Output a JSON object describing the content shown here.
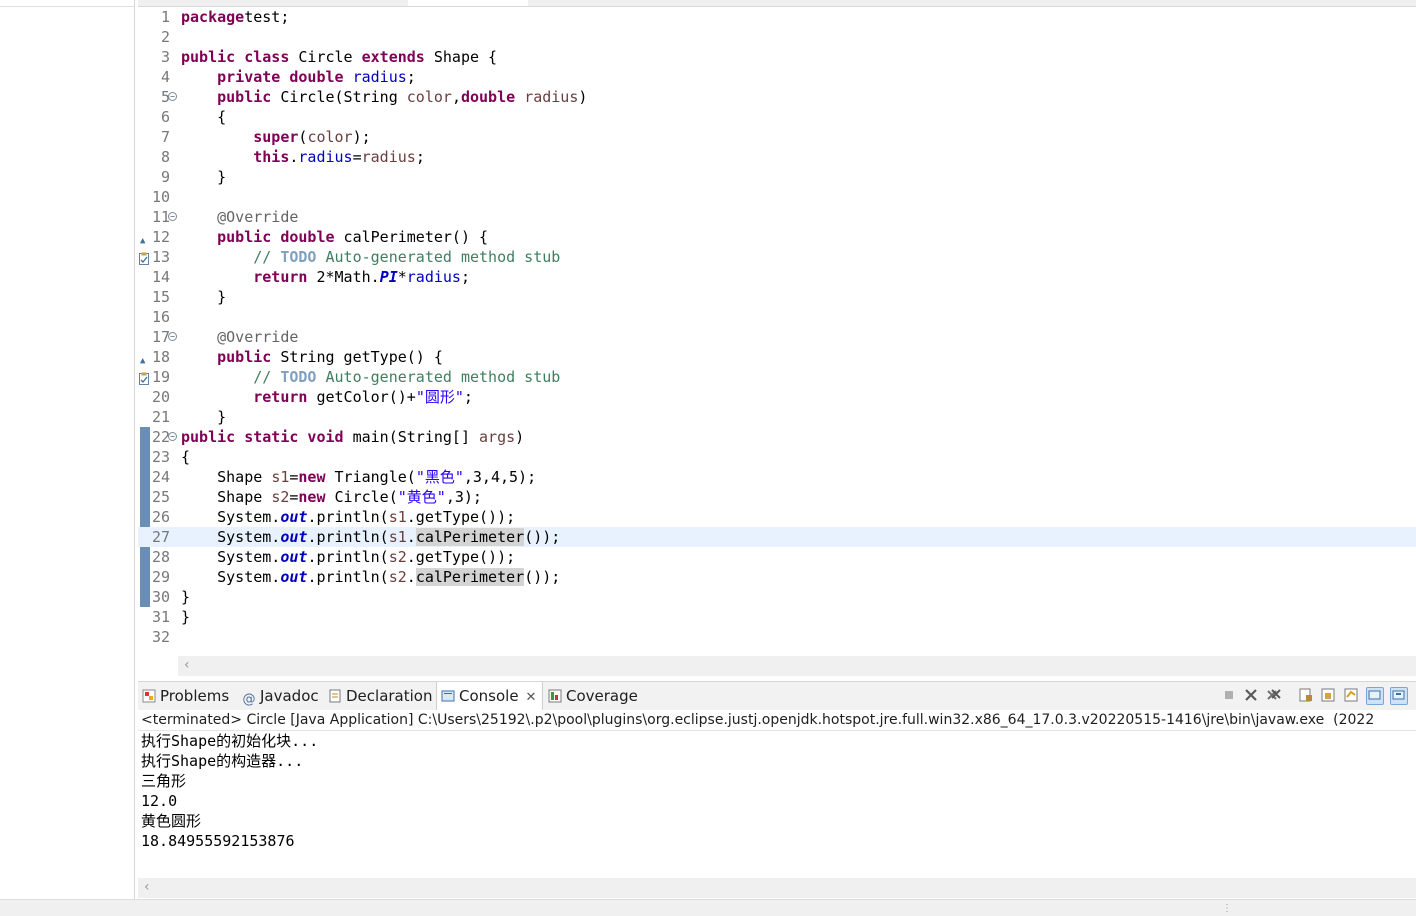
{
  "editor": {
    "lines": [
      {
        "n": "1",
        "parts": [
          [
            "kw",
            "package"
          ],
          [
            "",
            "test;"
          ]
        ]
      },
      {
        "n": "2",
        "parts": []
      },
      {
        "n": "3",
        "parts": [
          [
            "kw",
            "public class"
          ],
          [
            "",
            " Circle "
          ],
          [
            "kw",
            "extends"
          ],
          [
            "",
            " Shape {"
          ]
        ]
      },
      {
        "n": "4",
        "parts": [
          [
            "",
            "    "
          ],
          [
            "kw",
            "private double"
          ],
          [
            "",
            " "
          ],
          [
            "fld",
            "radius"
          ],
          [
            "",
            ";"
          ]
        ]
      },
      {
        "n": "5",
        "fold": true,
        "parts": [
          [
            "",
            "    "
          ],
          [
            "kw",
            "public"
          ],
          [
            "",
            " Circle(String "
          ],
          [
            "param",
            "color"
          ],
          [
            "",
            ","
          ],
          [
            "kw",
            "double"
          ],
          [
            "",
            " "
          ],
          [
            "param",
            "radius"
          ],
          [
            "",
            ")"
          ]
        ]
      },
      {
        "n": "6",
        "parts": [
          [
            "",
            "    {"
          ]
        ]
      },
      {
        "n": "7",
        "parts": [
          [
            "",
            "        "
          ],
          [
            "kw",
            "super"
          ],
          [
            "",
            "("
          ],
          [
            "param",
            "color"
          ],
          [
            "",
            ");"
          ]
        ]
      },
      {
        "n": "8",
        "parts": [
          [
            "",
            "        "
          ],
          [
            "kw",
            "this"
          ],
          [
            "",
            "."
          ],
          [
            "fld",
            "radius"
          ],
          [
            "",
            "="
          ],
          [
            "param",
            "radius"
          ],
          [
            "",
            ";"
          ]
        ]
      },
      {
        "n": "9",
        "parts": [
          [
            "",
            "    }"
          ]
        ]
      },
      {
        "n": "10",
        "parts": []
      },
      {
        "n": "11",
        "fold": true,
        "parts": [
          [
            "",
            "    "
          ],
          [
            "ann",
            "@Override"
          ]
        ]
      },
      {
        "n": "12",
        "override": true,
        "parts": [
          [
            "",
            "    "
          ],
          [
            "kw",
            "public double"
          ],
          [
            "",
            " calPerimeter() {"
          ]
        ]
      },
      {
        "n": "13",
        "task": true,
        "parts": [
          [
            "",
            "        "
          ],
          [
            "cmt",
            "// "
          ],
          [
            "todo",
            "TODO"
          ],
          [
            "cmt",
            " Auto-generated method stub"
          ]
        ]
      },
      {
        "n": "14",
        "parts": [
          [
            "",
            "        "
          ],
          [
            "kw",
            "return"
          ],
          [
            "",
            " 2*Math."
          ],
          [
            "sfld",
            "PI"
          ],
          [
            "",
            "*"
          ],
          [
            "fld",
            "radius"
          ],
          [
            "",
            ";"
          ]
        ]
      },
      {
        "n": "15",
        "parts": [
          [
            "",
            "    }"
          ]
        ]
      },
      {
        "n": "16",
        "parts": []
      },
      {
        "n": "17",
        "fold": true,
        "parts": [
          [
            "",
            "    "
          ],
          [
            "ann",
            "@Override"
          ]
        ]
      },
      {
        "n": "18",
        "override": true,
        "parts": [
          [
            "",
            "    "
          ],
          [
            "kw",
            "public"
          ],
          [
            "",
            " String getType() {"
          ]
        ]
      },
      {
        "n": "19",
        "task": true,
        "parts": [
          [
            "",
            "        "
          ],
          [
            "cmt",
            "// "
          ],
          [
            "todo",
            "TODO"
          ],
          [
            "cmt",
            " Auto-generated method stub"
          ]
        ]
      },
      {
        "n": "20",
        "parts": [
          [
            "",
            "        "
          ],
          [
            "kw",
            "return"
          ],
          [
            "",
            " getColor()+"
          ],
          [
            "str",
            "\"圆形\""
          ],
          [
            "",
            ";"
          ]
        ]
      },
      {
        "n": "21",
        "parts": [
          [
            "",
            "    }"
          ]
        ]
      },
      {
        "n": "22",
        "fold": true,
        "parts": [
          [
            "kw",
            "public static void"
          ],
          [
            "",
            " main(String[] "
          ],
          [
            "param",
            "args"
          ],
          [
            "",
            ")"
          ]
        ]
      },
      {
        "n": "23",
        "parts": [
          [
            "",
            "{"
          ]
        ]
      },
      {
        "n": "24",
        "parts": [
          [
            "",
            "    Shape "
          ],
          [
            "param",
            "s1"
          ],
          [
            "",
            "="
          ],
          [
            "kw",
            "new"
          ],
          [
            "",
            " Triangle("
          ],
          [
            "str",
            "\"黑色\""
          ],
          [
            "",
            ",3,4,5);"
          ]
        ]
      },
      {
        "n": "25",
        "parts": [
          [
            "",
            "    Shape "
          ],
          [
            "param",
            "s2"
          ],
          [
            "",
            "="
          ],
          [
            "kw",
            "new"
          ],
          [
            "",
            " Circle("
          ],
          [
            "str",
            "\"黄色\""
          ],
          [
            "",
            ",3);"
          ]
        ]
      },
      {
        "n": "26",
        "parts": [
          [
            "",
            "    System."
          ],
          [
            "sfld",
            "out"
          ],
          [
            "",
            ".println("
          ],
          [
            "param",
            "s1"
          ],
          [
            "",
            ".getType());"
          ]
        ]
      },
      {
        "n": "27",
        "current": true,
        "parts": [
          [
            "",
            "    System."
          ],
          [
            "sfld",
            "out"
          ],
          [
            "",
            ".println("
          ],
          [
            "param",
            "s1"
          ],
          [
            "",
            "."
          ],
          [
            "hl",
            "calPerimeter"
          ],
          [
            "",
            "());"
          ]
        ]
      },
      {
        "n": "28",
        "parts": [
          [
            "",
            "    System."
          ],
          [
            "sfld",
            "out"
          ],
          [
            "",
            ".println("
          ],
          [
            "param",
            "s2"
          ],
          [
            "",
            ".getType());"
          ]
        ]
      },
      {
        "n": "29",
        "parts": [
          [
            "",
            "    System."
          ],
          [
            "sfld",
            "out"
          ],
          [
            "",
            ".println("
          ],
          [
            "param",
            "s2"
          ],
          [
            "",
            "."
          ],
          [
            "hl",
            "calPerimeter"
          ],
          [
            "",
            "());"
          ]
        ]
      },
      {
        "n": "30",
        "parts": [
          [
            "",
            "}"
          ]
        ]
      },
      {
        "n": "31",
        "parts": [
          [
            "",
            "}"
          ]
        ]
      },
      {
        "n": "32",
        "parts": []
      }
    ]
  },
  "views": {
    "tabs": [
      {
        "label": "Problems",
        "icon": "problems-icon",
        "active": false
      },
      {
        "label": "Javadoc",
        "icon": "javadoc-icon",
        "active": false
      },
      {
        "label": "Declaration",
        "icon": "declaration-icon",
        "active": false
      },
      {
        "label": "Console",
        "icon": "console-icon",
        "active": true
      },
      {
        "label": "Coverage",
        "icon": "coverage-icon",
        "active": false
      }
    ],
    "toolbar_icons": [
      "terminate-icon",
      "remove-launch-icon",
      "remove-all-icon",
      "scroll-lock-icon",
      "word-wrap-icon",
      "pin-console-icon",
      "open-console-icon",
      "display-selected-icon"
    ]
  },
  "console": {
    "header": "<terminated> Circle [Java Application] C:\\Users\\25192\\.p2\\pool\\plugins\\org.eclipse.justj.openjdk.hotspot.jre.full.win32.x86_64_17.0.3.v20220515-1416\\jre\\bin\\javaw.exe  (2022",
    "output": [
      "执行Shape的初始化块...",
      "执行Shape的构造器...",
      "三角形",
      "12.0",
      "黄色圆形",
      "18.84955592153876"
    ]
  }
}
